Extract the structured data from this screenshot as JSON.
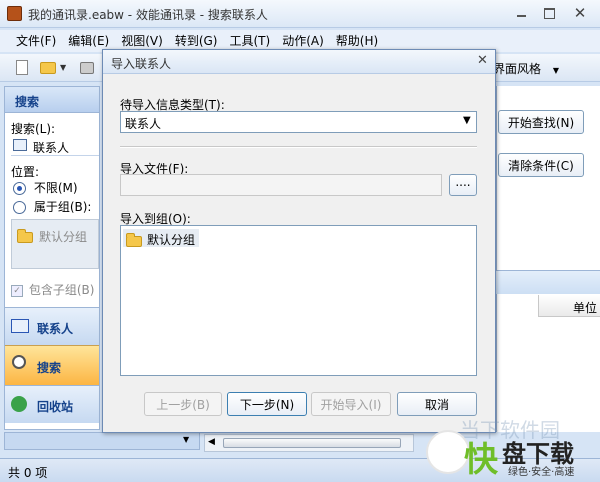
{
  "window": {
    "title": "我的通讯录.eabw - 效能通讯录 - 搜索联系人"
  },
  "menu": [
    "文件(F)",
    "编辑(E)",
    "视图(V)",
    "转到(G)",
    "工具(T)",
    "动作(A)",
    "帮助(H)"
  ],
  "toolbar": {
    "theme_label": "界面风格"
  },
  "sidebar": {
    "header": "搜索",
    "search_label": "搜索(L):",
    "search_value": "联系人",
    "position_label": "位置:",
    "radio_unlimited": "不限(M)",
    "radio_group": "属于组(B):",
    "group_item": "默认分组",
    "include_subgroups": "包含子组(B)",
    "nav": {
      "contacts": "联系人",
      "search": "搜索",
      "recycle": "回收站"
    }
  },
  "main": {
    "start_search": "开始查找(N)",
    "clear_conditions": "清除条件(C)",
    "column_unit": "单位"
  },
  "dialog": {
    "title": "导入联系人",
    "type_label": "待导入信息类型(T):",
    "type_value": "联系人",
    "file_label": "导入文件(F):",
    "file_value": "",
    "browse_button": "....",
    "group_label": "导入到组(O):",
    "group_item": "默认分组",
    "buttons": {
      "prev": "上一步(B)",
      "next": "下一步(N)",
      "start": "开始导入(I)",
      "cancel": "取消"
    }
  },
  "statusbar": {
    "text": "共 0 项"
  },
  "watermark": {
    "logo": "快",
    "name": "盘下载",
    "slogan": "绿色·安全·高速",
    "faded": "当下软件园"
  }
}
